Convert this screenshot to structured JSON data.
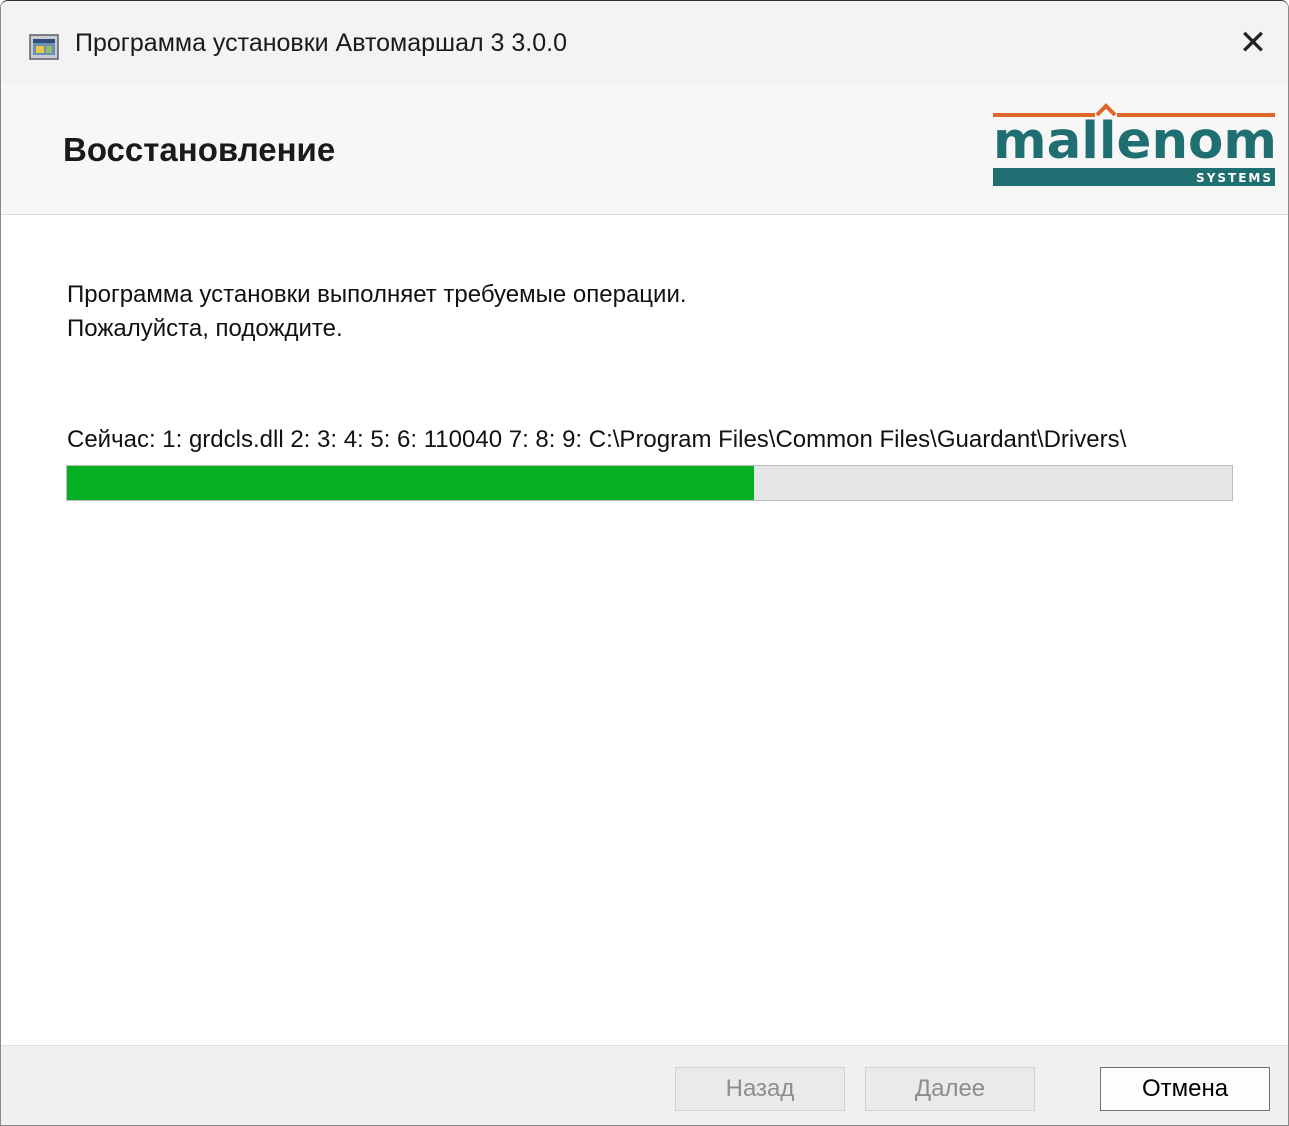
{
  "window": {
    "title": "Программа установки Автомаршал 3 3.0.0",
    "close_glyph": "✕"
  },
  "header": {
    "title": "Восстановление",
    "logo": {
      "wordmark": "mallenom",
      "tagline": "SYSTEMS",
      "colors": {
        "teal": "#1f6f72",
        "orange": "#e0672a"
      }
    }
  },
  "content": {
    "description_line1": "Программа установки выполняет требуемые операции.",
    "description_line2": "Пожалуйста, подождите.",
    "status_text": "Сейчас:  1: grdcls.dll 2:  3:  4:  5:  6: 110040 7:  8:  9: C:\\Program Files\\Common Files\\Guardant\\Drivers\\",
    "progress_fraction": 0.59,
    "progress_color": "#06b025"
  },
  "footer": {
    "back_label": "Назад",
    "next_label": "Далее",
    "cancel_label": "Отмена"
  }
}
